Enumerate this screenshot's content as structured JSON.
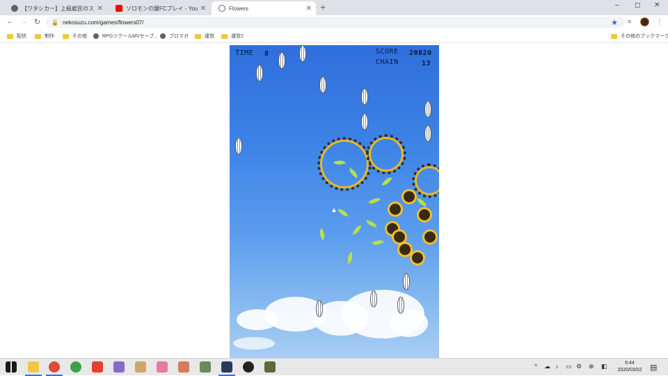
{
  "browser": {
    "tabs": [
      {
        "title": "【ワタシカー】上級雇民のススメ【オンラ",
        "favicon_color": "#5f6368",
        "active": false
      },
      {
        "title": "ソロモンの鍵FCプレイ - YouTube",
        "favicon_color": "#ff0000",
        "active": false
      },
      {
        "title": "Flowers",
        "favicon_color": "#5f6368",
        "active": true
      }
    ],
    "new_tab_label": "+",
    "window_controls": [
      "–",
      "◻",
      "✕"
    ],
    "url": "nekosuzu.com/games/flowers07/",
    "bookmarks": [
      {
        "label": "配信",
        "icon": "folder-icon"
      },
      {
        "label": "制作",
        "icon": "folder-icon"
      },
      {
        "label": "その他",
        "icon": "folder-icon"
      },
      {
        "label": "RPGツクールMVセーブ...",
        "icon": "globe-icon"
      },
      {
        "label": "ブロマガ",
        "icon": "globe-icon"
      },
      {
        "label": "運営",
        "icon": "folder-icon"
      },
      {
        "label": "運営2",
        "icon": "folder-icon"
      }
    ],
    "other_bookmarks": "その他のブックマーク"
  },
  "game": {
    "time_label": "TIME",
    "time_value": "8",
    "score_label": "SCORE",
    "score_value": "20820",
    "chain_label": "CHAIN",
    "chain_value": "13"
  },
  "taskbar": {
    "time": "6:44",
    "date": "2020/03/02"
  },
  "colors": {
    "sky_top": "#2f6fdc",
    "sky_bottom": "#a9cdf3",
    "accent": "#1a73e8"
  }
}
